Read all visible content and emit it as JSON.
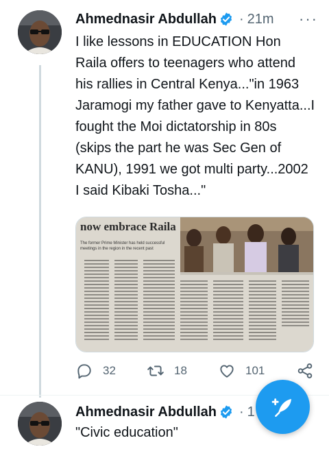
{
  "tweets": [
    {
      "author": "Ahmednasir Abdullah",
      "verified": true,
      "separator": "·",
      "time": "21m",
      "text": "I like lessons in EDUCATION Hon Raila offers to teenagers who attend his rallies in Central Kenya...\"in 1963 Jaramogi my father gave to Kenyatta...I fought the Moi dictatorship in 80s (skips the part he was Sec Gen of KANU), 1991 we got multi party...2002 I said Kibaki Tosha...\"",
      "media": {
        "headline": "now embrace Raila",
        "subhead": "The former Prime Minister has held successful meetings in the region in the recent past"
      },
      "stats": {
        "replies": "32",
        "retweets": "18",
        "likes": "101"
      }
    },
    {
      "author": "Ahmednasir Abdullah",
      "verified": true,
      "separator": "·",
      "time": "1",
      "text": "\"Civic education\""
    }
  ],
  "icons": {
    "more": "more-dots-icon",
    "reply": "reply-icon",
    "retweet": "retweet-icon",
    "like": "heart-icon",
    "share": "share-icon",
    "compose": "compose-icon"
  },
  "colors": {
    "accent": "#1d9bf0",
    "muted": "#536471",
    "text": "#0f1419"
  }
}
